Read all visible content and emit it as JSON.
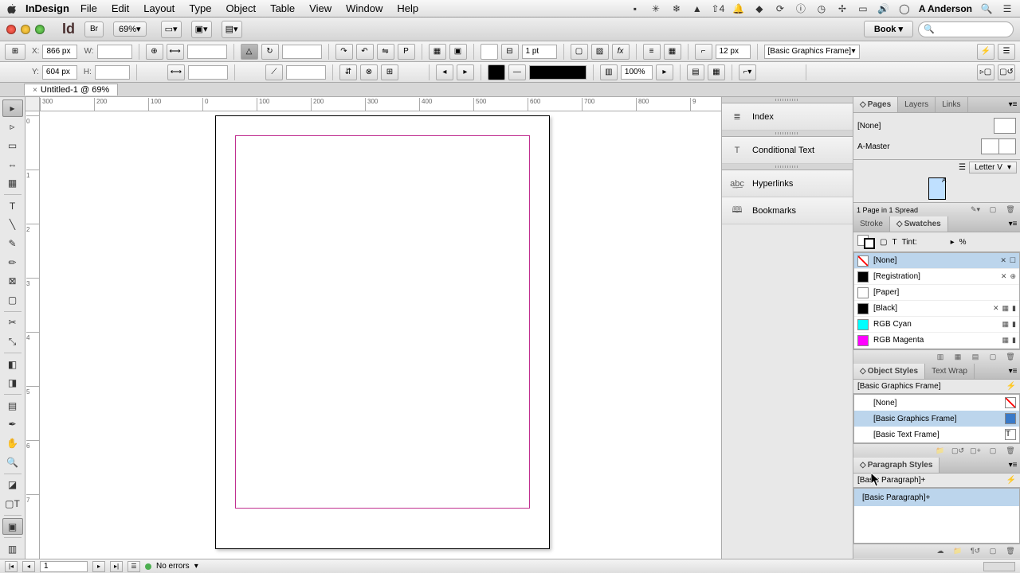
{
  "os": {
    "app_name": "InDesign",
    "menus": [
      "File",
      "Edit",
      "Layout",
      "Type",
      "Object",
      "Table",
      "View",
      "Window",
      "Help"
    ],
    "user": "A Anderson",
    "tray_count": "4"
  },
  "window": {
    "zoom": "69%",
    "workspace": "Book"
  },
  "control": {
    "x_label": "X:",
    "y_label": "Y:",
    "w_label": "W:",
    "h_label": "H:",
    "x_value": "866 px",
    "y_value": "604 px",
    "stroke_weight": "1 pt",
    "stroke_pct": "12 px",
    "scale_pct": "100%",
    "style_applied": "[Basic Graphics Frame]"
  },
  "document": {
    "tab_title": "Untitled-1 @ 69%",
    "ruler_h": [
      "300",
      "200",
      "100",
      "0",
      "100",
      "200",
      "300",
      "400",
      "500",
      "600",
      "700",
      "800",
      "9"
    ],
    "ruler_v": [
      "0",
      "1",
      "2",
      "3",
      "4",
      "5",
      "6",
      "7"
    ]
  },
  "side_panels": [
    "Index",
    "Conditional Text",
    "Hyperlinks",
    "Bookmarks"
  ],
  "pages": {
    "tabs": [
      "Pages",
      "Layers",
      "Links"
    ],
    "none": "[None]",
    "master": "A-Master",
    "preset": "Letter V",
    "footer": "1 Page in 1 Spread",
    "thumb_a": "A"
  },
  "swatches": {
    "tabs": [
      "Stroke",
      "Swatches"
    ],
    "tint_label": "Tint:",
    "tint_unit": "%",
    "items": [
      {
        "name": "[None]",
        "color": "none"
      },
      {
        "name": "[Registration]",
        "color": "#000"
      },
      {
        "name": "[Paper]",
        "color": "#fff"
      },
      {
        "name": "[Black]",
        "color": "#000"
      },
      {
        "name": "RGB Cyan",
        "color": "#00ffff"
      },
      {
        "name": "RGB Magenta",
        "color": "#ff00ff"
      }
    ]
  },
  "object_styles": {
    "tabs": [
      "Object Styles",
      "Text Wrap"
    ],
    "current": "[Basic Graphics Frame]",
    "items": [
      "[None]",
      "[Basic Graphics Frame]",
      "[Basic Text Frame]"
    ]
  },
  "para_styles": {
    "tab": "Paragraph Styles",
    "current": "[Basic Paragraph]+",
    "item": "[Basic Paragraph]+"
  },
  "status": {
    "page": "1",
    "errors": "No errors"
  }
}
